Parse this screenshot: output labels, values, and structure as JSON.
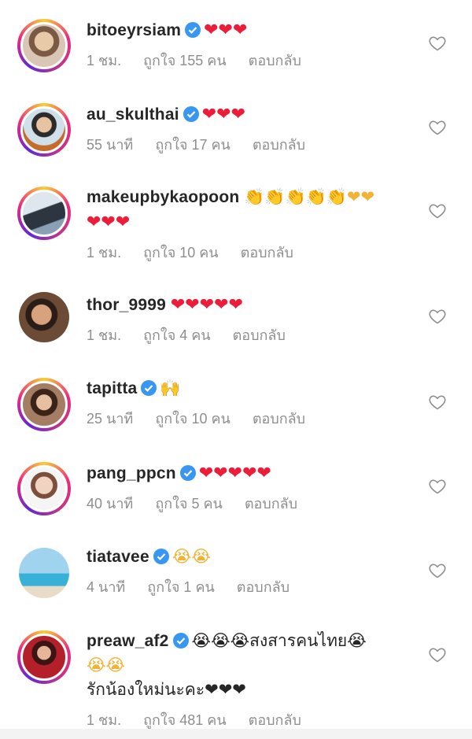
{
  "comments": [
    {
      "username": "bitoeyrsiam",
      "verified": true,
      "text": "❤❤❤",
      "extra": "",
      "time": "1 ชม.",
      "likes": "ถูกใจ 155 คน",
      "reply": "ตอบกลับ"
    },
    {
      "username": "au_skulthai",
      "verified": true,
      "text": "❤❤❤",
      "extra": "",
      "time": "55 นาที",
      "likes": "ถูกใจ 17 คน",
      "reply": "ตอบกลับ"
    },
    {
      "username": "makeupbykaopoon",
      "verified": false,
      "text": "👏👏👏👏👏❤❤",
      "extra": "❤❤❤",
      "time": "1 ชม.",
      "likes": "ถูกใจ 10 คน",
      "reply": "ตอบกลับ"
    },
    {
      "username": "thor_9999",
      "verified": false,
      "text": "❤❤❤❤❤",
      "extra": "",
      "time": "1 ชม.",
      "likes": "ถูกใจ 4 คน",
      "reply": "ตอบกลับ"
    },
    {
      "username": "tapitta",
      "verified": true,
      "text": "🙌",
      "extra": "",
      "time": "25 นาที",
      "likes": "ถูกใจ 10 คน",
      "reply": "ตอบกลับ"
    },
    {
      "username": "pang_ppcn",
      "verified": true,
      "text": "❤❤❤❤❤",
      "extra": "",
      "time": "40 นาที",
      "likes": "ถูกใจ 5 คน",
      "reply": "ตอบกลับ"
    },
    {
      "username": "tiatavee",
      "verified": true,
      "text": "😭😭",
      "extra": "",
      "time": "4 นาที",
      "likes": "ถูกใจ 1 คน",
      "reply": "ตอบกลับ"
    },
    {
      "username": "preaw_af2",
      "verified": true,
      "text": "😭😭😭สงสารคนไทย😭",
      "extra": "😭😭",
      "extra2": "รักน้องใหม่นะคะ❤❤❤",
      "time": "1 ชม.",
      "likes": "ถูกใจ 481 คน",
      "reply": "ตอบกลับ"
    }
  ],
  "colors": {
    "heart": "#ed1d3a",
    "verified": "#3897f0",
    "meta": "#8e8e8e"
  },
  "icons": {
    "verified": "verified-badge-icon",
    "like": "heart-outline-icon"
  }
}
